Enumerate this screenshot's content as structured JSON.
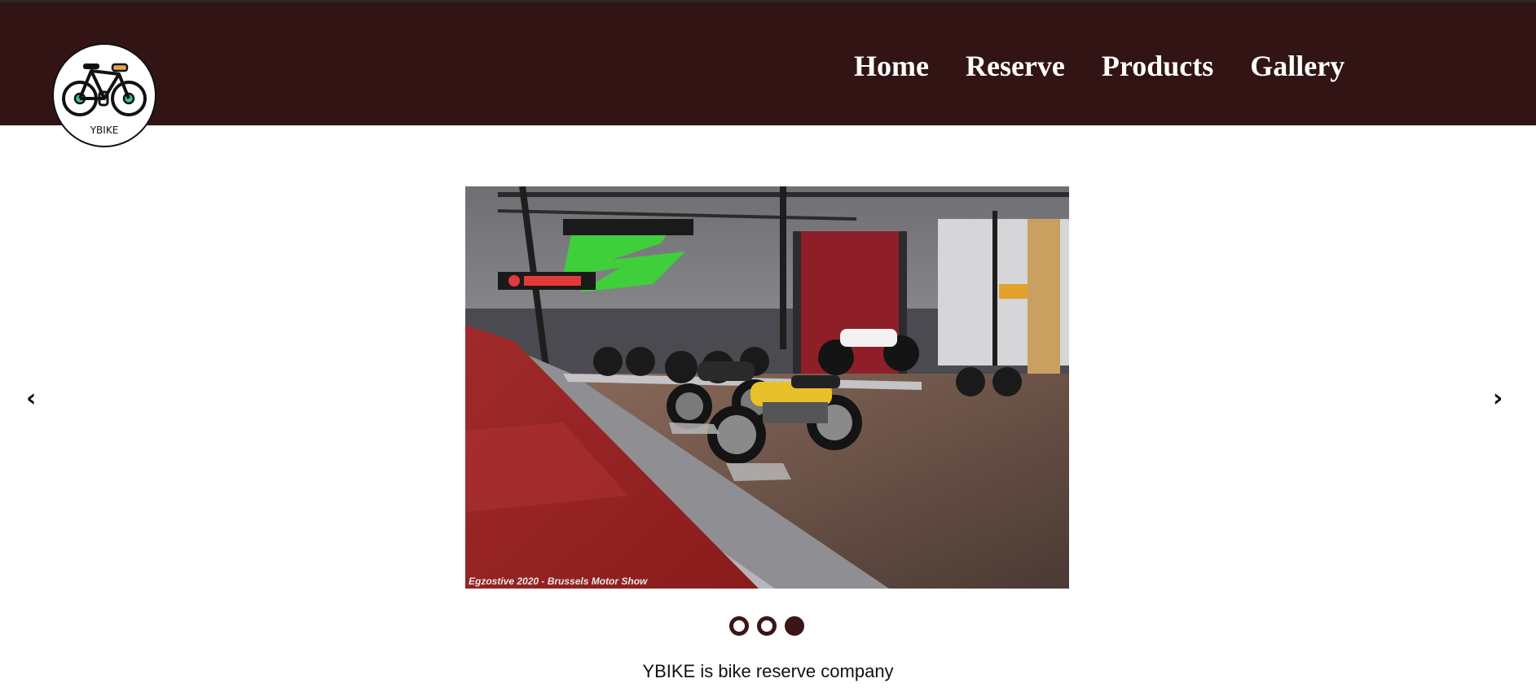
{
  "brand": {
    "logo_text": "YBIKE"
  },
  "nav": {
    "items": [
      "Home",
      "Reserve",
      "Products",
      "Gallery"
    ]
  },
  "slider": {
    "prev_glyph": "‹",
    "next_glyph": "›",
    "image_caption": "Egzostive 2020 - Brussels Motor Show",
    "slide_count": 3,
    "active_slide": 3
  },
  "tagline": "YBIKE is bike reserve company",
  "colors": {
    "header_bg": "#331414",
    "dot": "#3b1616",
    "nav_text": "#ffffff"
  },
  "icons": {
    "logo": "bicycle-icon",
    "prev": "chevron-left-icon",
    "next": "chevron-right-icon"
  }
}
